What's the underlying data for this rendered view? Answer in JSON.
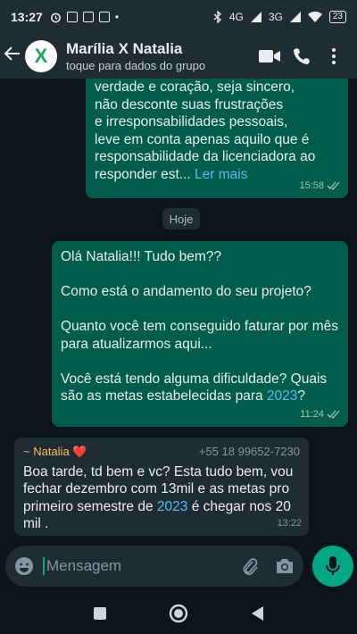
{
  "status_bar": {
    "time": "13:27",
    "network": "4G",
    "network2": "3G",
    "battery": "23"
  },
  "header": {
    "title": "Marília X Natalia",
    "subtitle": "toque para dados do grupo",
    "avatar_text": "X"
  },
  "messages": [
    {
      "direction": "out",
      "lines": [
        "verdade e coração, seja sincero,",
        "não desconte suas frustrações",
        "e irresponsabilidades pessoais,",
        "leve em conta apenas aquilo que é",
        "responsabilidade da licenciadora ao",
        "responder est..."
      ],
      "read_more": "Ler mais",
      "time": "15:58"
    },
    {
      "direction": "out",
      "p1": "Olá Natalia!!! Tudo bem??",
      "p2": "Como está o andamento do seu projeto?",
      "p3": "Quanto você tem conseguido faturar por mês para atualizarmos aqui...",
      "p4a": "Você está tendo alguma dificuldade? Quais são as metas estabelecidas para",
      "p4_link": "2023",
      "p4b": "?",
      "time": "11:24"
    },
    {
      "direction": "in",
      "sender": "~ Natalia ❤️",
      "phone": "+55 18 99652-7230",
      "text_a": "Boa tarde, td bem e vc? Esta tudo bem, vou fechar dezembro com 13mil e as metas pro primeiro semestre de",
      "link": "2023",
      "text_b": "é chegar nos 20 mil .",
      "time": "13:22"
    }
  ],
  "date_chip": "Hoje",
  "input": {
    "placeholder": "Mensagem"
  },
  "colors": {
    "outgoing": "#005c4b",
    "incoming": "#1f2c34",
    "accent": "#00a884",
    "link": "#53bdeb"
  }
}
